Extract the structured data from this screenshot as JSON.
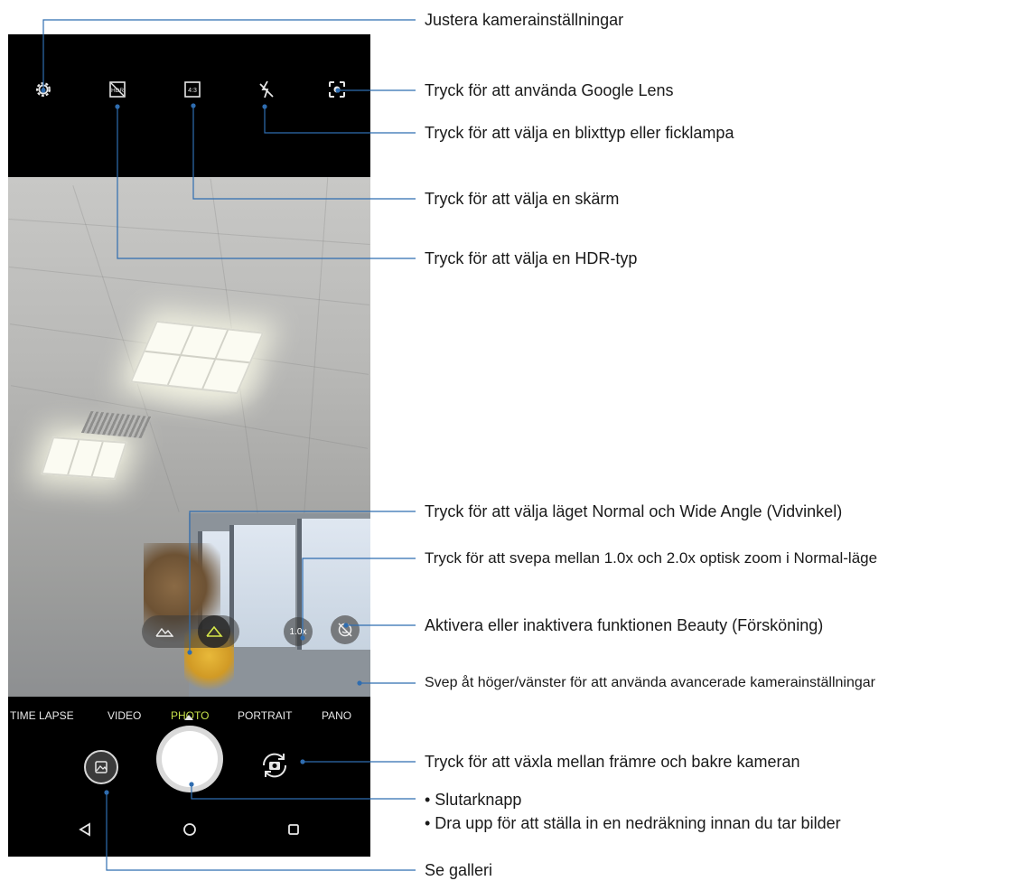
{
  "camera": {
    "top_icons": [
      {
        "name": "settings-icon"
      },
      {
        "name": "hdr-icon"
      },
      {
        "name": "aspect-ratio-icon",
        "text": "4:3"
      },
      {
        "name": "flash-off-icon"
      },
      {
        "name": "google-lens-icon"
      }
    ],
    "zoom_label": "1.0x",
    "modes": [
      "TIME LAPSE",
      "VIDEO",
      "PHOTO",
      "PORTRAIT",
      "PANO"
    ],
    "active_mode": "PHOTO",
    "active_mode_color": "#c6e04a",
    "wide_angle_active_color": "#d6e84a",
    "nav": [
      "back-icon",
      "home-icon",
      "recents-icon"
    ]
  },
  "callouts": {
    "settings": "Justera kamerainställningar",
    "google_lens": "Tryck för att använda Google Lens",
    "flash": "Tryck för att välja en blixttyp eller ficklampa",
    "screen": "Tryck för att välja en skärm",
    "hdr": "Tryck för att välja en HDR-typ",
    "wide_angle": "Tryck för att välja läget Normal och Wide Angle (Vidvinkel)",
    "zoom": "Tryck för att svepa mellan 1.0x och 2.0x optisk zoom i Normal-läge",
    "beauty": "Aktivera eller inaktivera funktionen Beauty (Försköning)",
    "modes": "Svep åt höger/vänster för att använda avancerade kamerainställningar",
    "switch_camera": "Tryck för att växla mellan främre och bakre kameran",
    "shutter_1": "• Slutarknapp",
    "shutter_2": "• Dra upp för att ställa in en nedräkning innan du tar bilder",
    "gallery": "Se galleri"
  }
}
